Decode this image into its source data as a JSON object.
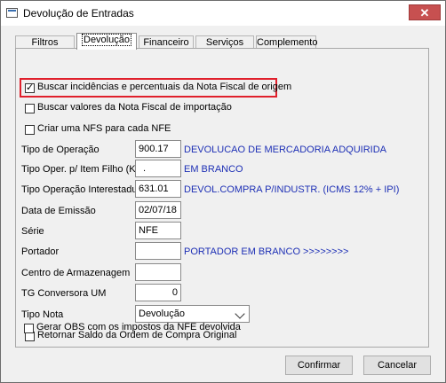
{
  "window": {
    "title": "Devolução de Entradas",
    "close_glyph": "✕"
  },
  "tabs": [
    {
      "label": "Filtros"
    },
    {
      "label": "Devolução"
    },
    {
      "label": "Financeiro"
    },
    {
      "label": "Serviços"
    },
    {
      "label": "Complemento"
    }
  ],
  "checkboxes": {
    "buscar_incidencias": {
      "label": "Buscar incidências e percentuais da Nota Fiscal de origem",
      "checked": true
    },
    "buscar_valores": {
      "label": "Buscar valores da Nota Fiscal de importação",
      "checked": false
    },
    "criar_nfs": {
      "label": "Criar uma NFS para cada NFE",
      "checked": false
    },
    "retornar_saldo": {
      "label": "Retornar Saldo da Ordem de Compra Original",
      "checked": false
    },
    "gerar_obs": {
      "label": "Gerar OBS com os impostos da NFE devolvida",
      "checked": false
    }
  },
  "fields": {
    "tipo_operacao": {
      "label": "Tipo de Operação",
      "value": "900.17",
      "description": "DEVOLUCAO DE MERCADORIA ADQUIRIDA"
    },
    "tipo_oper_item": {
      "label": "Tipo Oper. p/ Item Filho (Kit)",
      "value": ".",
      "description": "EM BRANCO"
    },
    "tipo_op_interestadual": {
      "label": "Tipo Operação Interestadual",
      "value": "631.01",
      "description": "DEVOL.COMPRA P/INDUSTR. (ICMS 12% + IPI)"
    },
    "data_emissao": {
      "label": "Data de Emissão",
      "value": "02/07/18"
    },
    "serie": {
      "label": "Série",
      "value": "NFE"
    },
    "portador": {
      "label": "Portador",
      "value": "",
      "description": "PORTADOR EM BRANCO >>>>>>>>"
    },
    "centro_armazenagem": {
      "label": "Centro de Armazenagem",
      "value": ""
    },
    "tg_conversora": {
      "label": "TG Conversora UM",
      "value": "0"
    },
    "tipo_nota": {
      "label": "Tipo Nota",
      "value": "Devolução"
    }
  },
  "buttons": {
    "confirm": "Confirmar",
    "cancel": "Cancelar"
  },
  "colors": {
    "highlight": "#e0202c",
    "description_text": "#1d2fb5",
    "close_button": "#c75050"
  }
}
